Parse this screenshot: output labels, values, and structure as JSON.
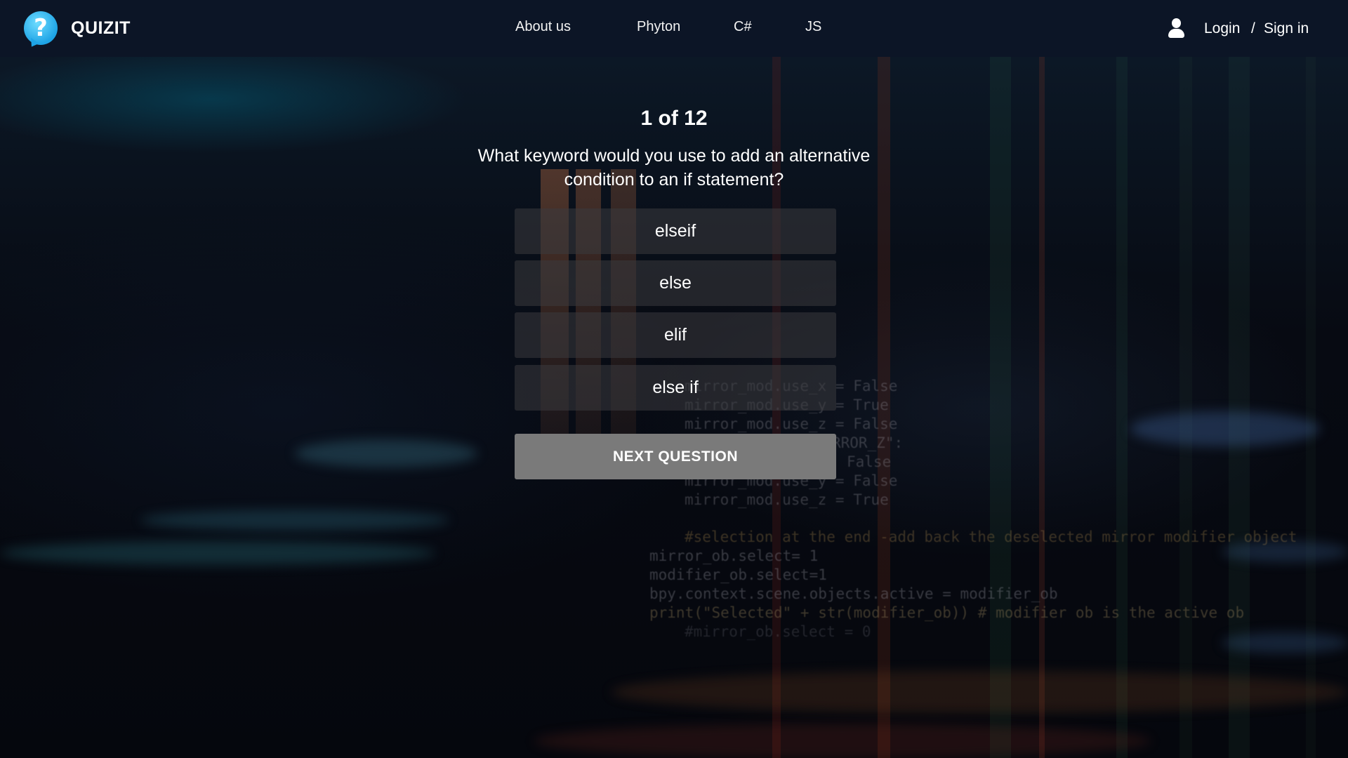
{
  "header": {
    "brand": "QUIZIT",
    "nav": [
      "About us",
      "Phyton",
      "C#",
      "JS"
    ],
    "login_label": "Login",
    "separator": "/",
    "signin_label": "Sign in"
  },
  "quiz": {
    "counter": "1 of 12",
    "question": "What keyword would you use to add an alternative condition to an if statement?",
    "answers": [
      "elseif",
      "else",
      "elif",
      "else if"
    ],
    "next_label": "NEXT QUESTION"
  },
  "background_code": [
    "mirror_mod.use_x = False",
    "mirror_mod.use_y = True",
    "mirror_mod.use_z = False",
    "RROR_Z\":",
    "False",
    "mirror_mod.use_y = False",
    "mirror_mod.use_z = True",
    "#selection at the end -add back the deselected mirror modifier object",
    "mirror_ob.select= 1",
    "modifier_ob.select=1",
    "bpy.context.scene.objects.active = modifier_ob",
    "print(\"Selected\" + str(modifier_ob)) # modifier ob is the active ob",
    "#mirror_ob.select = 0"
  ],
  "colors": {
    "header_bg": "#0c1526",
    "logo_blue": "#1ea4e6",
    "answer_bg": "#3a3a3e",
    "next_bg": "#7a7a7a"
  }
}
